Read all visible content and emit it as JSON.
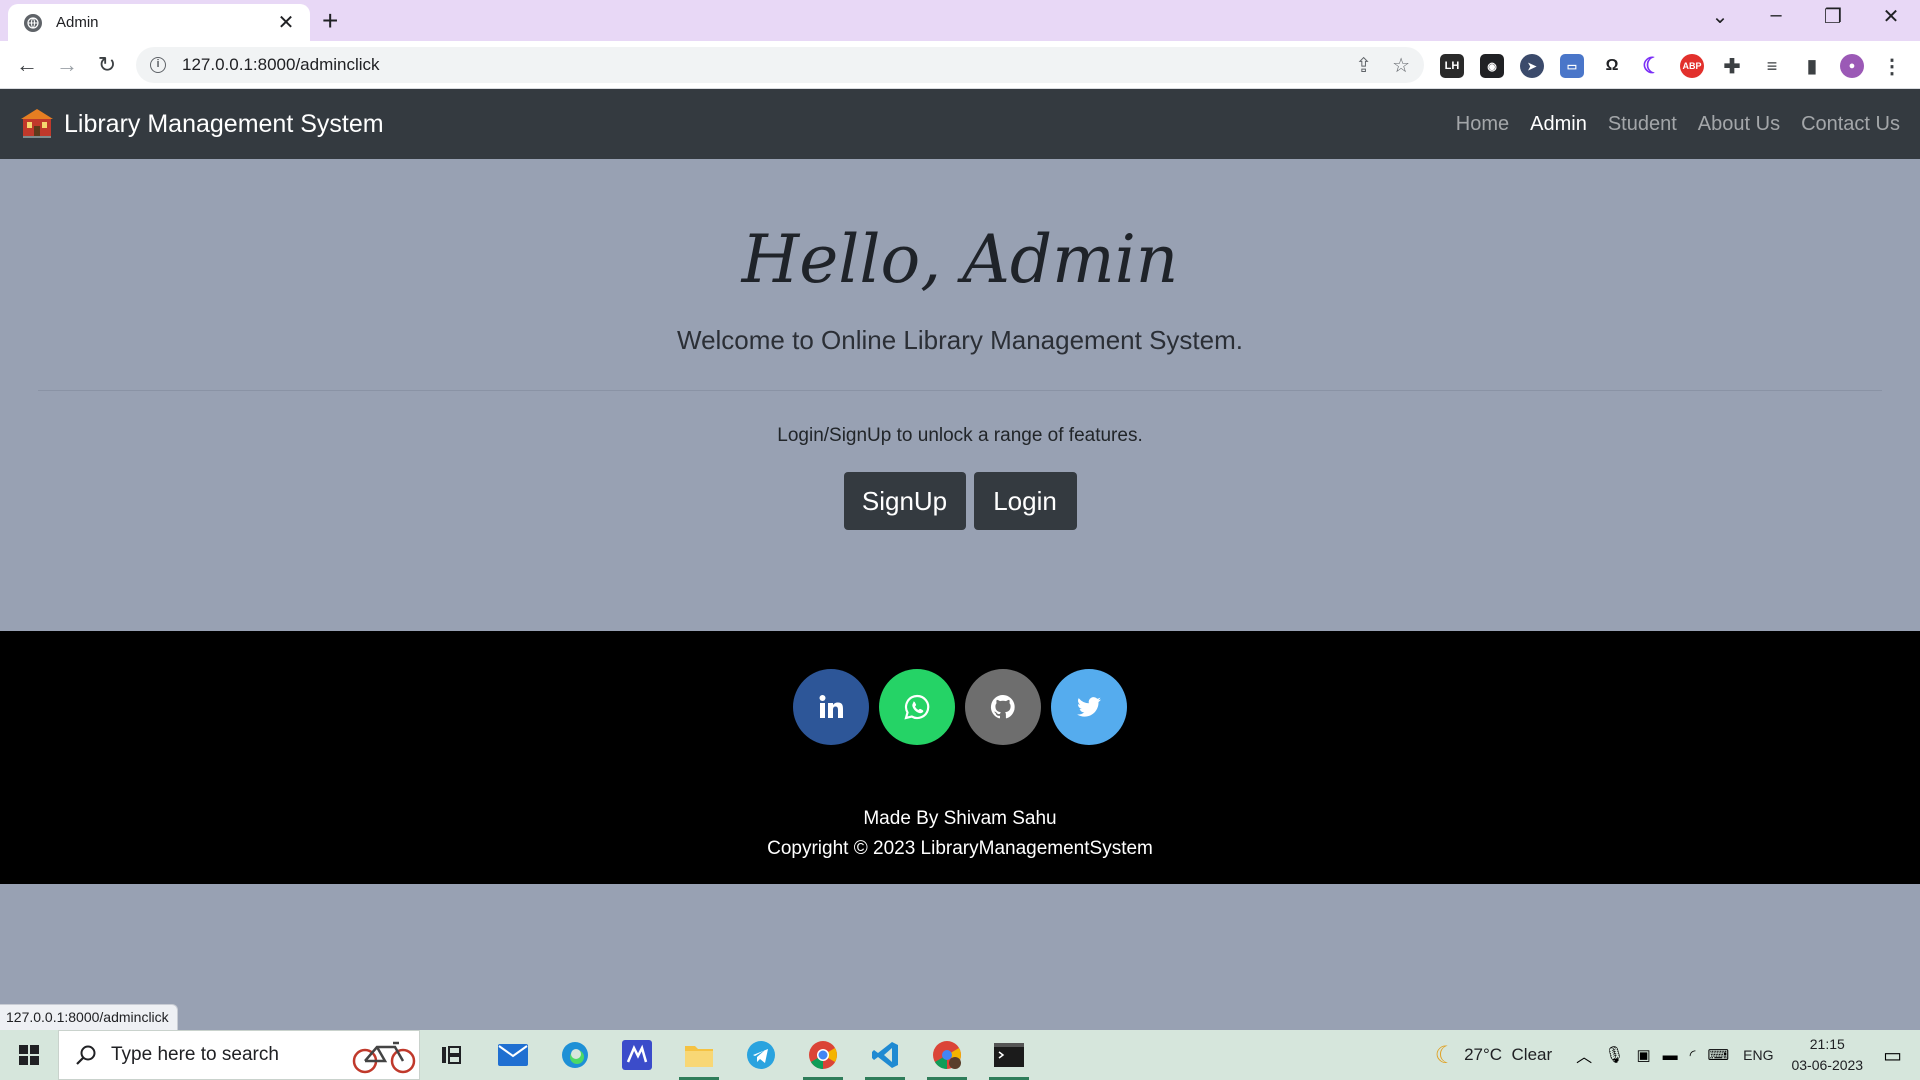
{
  "browser": {
    "tab_title": "Admin",
    "url": "127.0.0.1:8000/adminclick",
    "status_url": "127.0.0.1:8000/adminclick",
    "extensions": [
      "LH",
      "ABP"
    ]
  },
  "navbar": {
    "brand": "Library Management System",
    "links": [
      "Home",
      "Admin",
      "Student",
      "About Us",
      "Contact Us"
    ],
    "active_link": "Admin"
  },
  "hero": {
    "title": "Hello, Admin",
    "lead": "Welcome to Online Library Management System.",
    "text": "Login/SignUp to unlock a range of features.",
    "signup_label": "SignUp",
    "login_label": "Login"
  },
  "footer": {
    "social": [
      {
        "name": "linkedin-icon",
        "color": "#2d5698"
      },
      {
        "name": "whatsapp-icon",
        "color": "#25d366"
      },
      {
        "name": "github-icon",
        "color": "#6e6e6e"
      },
      {
        "name": "twitter-icon",
        "color": "#55acee"
      }
    ],
    "credit": "Made By Shivam Sahu",
    "copyright": "Copyright © 2023 LibraryManagementSystem"
  },
  "taskbar": {
    "search_placeholder": "Type here to search",
    "weather": "27°C  Clear",
    "language": "ENG",
    "time": "21:15",
    "date": "03-06-2023"
  }
}
